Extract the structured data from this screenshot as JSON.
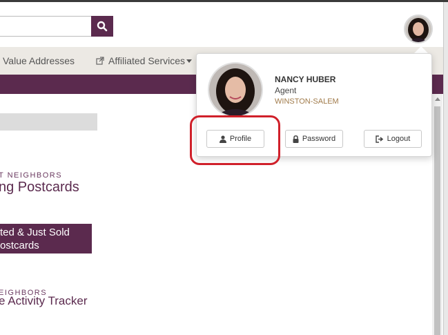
{
  "header": {
    "search": {
      "value": "",
      "placeholder": ""
    },
    "search_icon": "search-icon",
    "avatar": "user-avatar"
  },
  "nav": {
    "items": [
      {
        "label": "Value Addresses"
      },
      {
        "label": "Affiliated Services",
        "icon": "external-link-icon"
      }
    ]
  },
  "content": {
    "brand1_small": "T NEIGHBORS",
    "brand1_large": "ng Postcards",
    "promo_line1": "ted & Just Sold",
    "promo_line2": "ostcards",
    "brand2_small": "EIGHBORS",
    "brand2_large": "e Activity Tracker"
  },
  "user_menu": {
    "name": "NANCY HUBER",
    "role": "Agent",
    "location": "WINSTON-SALEM",
    "buttons": {
      "profile": "Profile",
      "password": "Password",
      "logout": "Logout"
    }
  },
  "colors": {
    "brand_purple": "#5b2a4e",
    "nav_bg": "#ece9e4",
    "highlight_red": "#d0202a",
    "location_tan": "#a07a4a"
  }
}
